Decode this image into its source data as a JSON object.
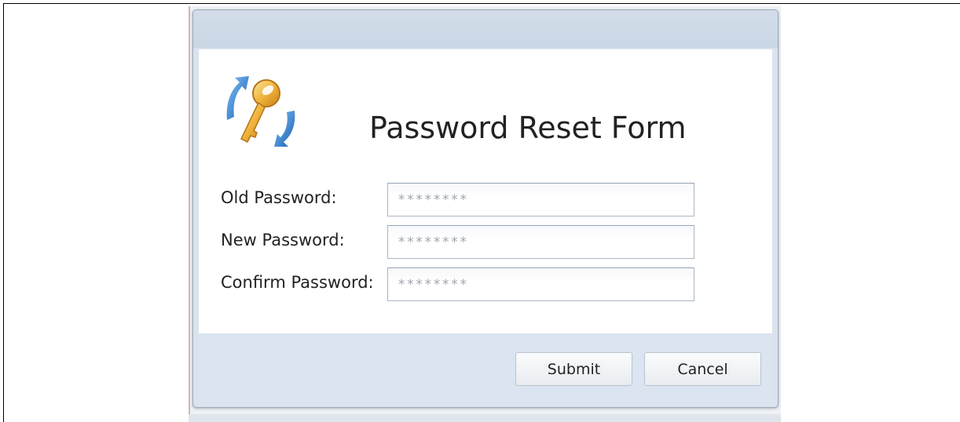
{
  "dialog": {
    "title": "Password Reset Form",
    "logo_icon": "key-refresh-icon"
  },
  "fields": {
    "old_password": {
      "label": "Old Password:",
      "placeholder": "********"
    },
    "new_password": {
      "label": "New Password:",
      "placeholder": "********"
    },
    "confirm_password": {
      "label": "Confirm Password:",
      "placeholder": "********"
    }
  },
  "buttons": {
    "submit": "Submit",
    "cancel": "Cancel"
  },
  "colors": {
    "title_bar": "#ccd8e6",
    "button_bar": "#dbe5f1",
    "input_border": "#a8b6c6",
    "arrow_blue": "#2a7fd4",
    "key_gold": "#e8a82a"
  }
}
